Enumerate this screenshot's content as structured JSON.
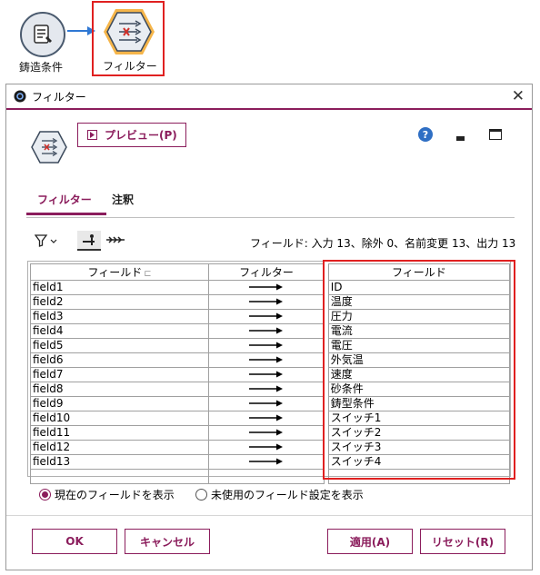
{
  "canvas": {
    "source_node_label": "鋳造条件",
    "filter_node_label": "フィルター"
  },
  "dialog": {
    "title": "フィルター",
    "preview_label": "プレビュー(P)",
    "help_glyph": "?",
    "tabs": [
      "フィルター",
      "注釈"
    ],
    "summary": "フィールド: 入力 13、除外 0、名前変更 13、出力 13",
    "columns": [
      "フィールド",
      "フィルター",
      "フィールド"
    ],
    "rows": [
      {
        "in": "field1",
        "out": "ID"
      },
      {
        "in": "field2",
        "out": "温度"
      },
      {
        "in": "field3",
        "out": "圧力"
      },
      {
        "in": "field4",
        "out": "電流"
      },
      {
        "in": "field5",
        "out": "電圧"
      },
      {
        "in": "field6",
        "out": "外気温"
      },
      {
        "in": "field7",
        "out": "速度"
      },
      {
        "in": "field8",
        "out": "砂条件"
      },
      {
        "in": "field9",
        "out": "鋳型条件"
      },
      {
        "in": "field10",
        "out": "スイッチ1"
      },
      {
        "in": "field11",
        "out": "スイッチ2"
      },
      {
        "in": "field12",
        "out": "スイッチ3"
      },
      {
        "in": "field13",
        "out": "スイッチ4"
      }
    ],
    "radio_current": "現在のフィールドを表示",
    "radio_unused": "未使用のフィールド設定を表示",
    "radio_selected": "current",
    "buttons": {
      "ok": "OK",
      "cancel": "キャンセル",
      "apply": "適用(A)",
      "reset": "リセット(R)"
    }
  },
  "colors": {
    "accent": "#8b1d5c",
    "highlight": "#e02020",
    "help_blue": "#2f6fc4"
  },
  "icons": [
    "script-icon",
    "filter-node-icon",
    "close-icon",
    "play-icon",
    "help-icon",
    "minimize-icon",
    "maximize-icon",
    "funnel-icon",
    "field-op-icon",
    "arrows-icon",
    "arrow-right-icon"
  ]
}
